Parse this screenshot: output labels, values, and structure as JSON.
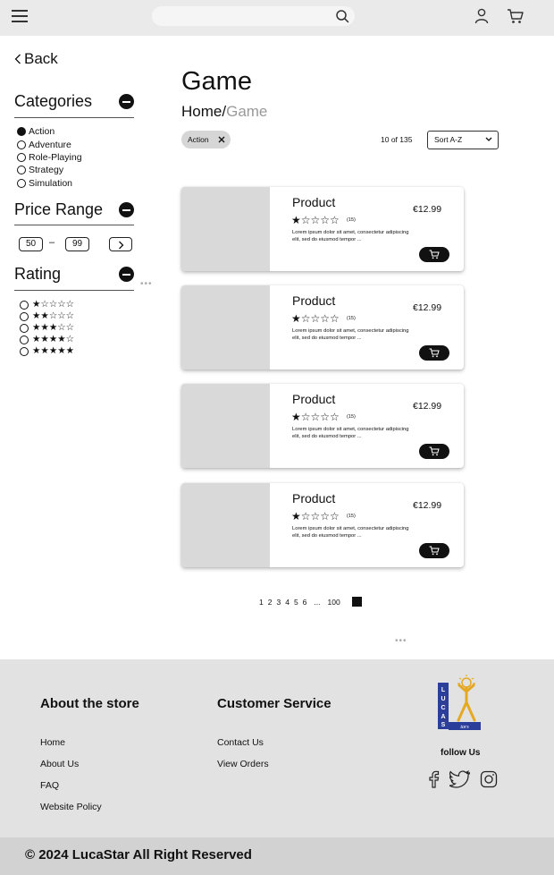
{
  "header": {
    "search_placeholder": "",
    "icons": [
      "hamburger-menu-icon",
      "search-icon",
      "user-icon",
      "cart-icon"
    ]
  },
  "sidebar": {
    "back_label": "Back",
    "categories_title": "Categories",
    "categories": [
      {
        "label": "Action",
        "selected": true
      },
      {
        "label": "Adventure",
        "selected": false
      },
      {
        "label": "Role-Playing",
        "selected": false
      },
      {
        "label": "Strategy",
        "selected": false
      },
      {
        "label": "Simulation",
        "selected": false
      }
    ],
    "price_title": "Price Range",
    "price_min": "50",
    "price_separator": "–",
    "price_max": "99",
    "rating_title": "Rating",
    "ratings": [
      {
        "stars": "★☆☆☆☆",
        "value": 1
      },
      {
        "stars": "★★☆☆☆",
        "value": 2
      },
      {
        "stars": "★★★☆☆",
        "value": 3
      },
      {
        "stars": "★★★★☆",
        "value": 4
      },
      {
        "stars": "★★★★★",
        "value": 5
      }
    ]
  },
  "main": {
    "title": "Game",
    "breadcrumb_home": "Home",
    "breadcrumb_sep": "/",
    "breadcrumb_current": "Game",
    "filter_chip": "Action",
    "result_count": "10 of 135",
    "sort_label": "Sort A-Z",
    "products": [
      {
        "name": "Product",
        "stars": "★☆☆☆☆",
        "reviews": "(15)",
        "description": "Lorem ipsum dolor sit amet, consectetur adipiscing elit, sed do eiusmod tempor ...",
        "price": "€12.99"
      },
      {
        "name": "Product",
        "stars": "★☆☆☆☆",
        "reviews": "(15)",
        "description": "Lorem ipsum dolor sit amet, consectetur adipiscing elit, sed do eiusmod tempor ...",
        "price": "€12.99"
      },
      {
        "name": "Product",
        "stars": "★☆☆☆☆",
        "reviews": "(15)",
        "description": "Lorem ipsum dolor sit amet, consectetur adipiscing elit, sed do eiusmod tempor ...",
        "price": "€12.99"
      },
      {
        "name": "Product",
        "stars": "★☆☆☆☆",
        "reviews": "(15)",
        "description": "Lorem ipsum dolor sit amet, consectetur adipiscing elit, sed do eiusmod tempor ...",
        "price": "€12.99"
      }
    ],
    "pagination": {
      "pages": [
        "1",
        "2",
        "3",
        "4",
        "5",
        "6"
      ],
      "ellipsis": "...",
      "last": "100"
    }
  },
  "footer": {
    "about_title": "About the store",
    "about_links": [
      "Home",
      "About Us",
      "FAQ",
      "Website Policy"
    ],
    "service_title": "Customer Service",
    "service_links": [
      "Contact Us",
      "View Orders"
    ],
    "logo_text": "LUCAStars",
    "follow_label": "follow Us",
    "social_icons": [
      "facebook-icon",
      "twitter-icon",
      "instagram-icon"
    ],
    "copyright": "© 2024 LucaStar All Right Reserved"
  },
  "colors": {
    "header_bg": "#eaeaea",
    "footer_bg": "#e2e2e2",
    "copyright_bg": "#d2d2d2",
    "image_placeholder": "#d9d9d9",
    "chip_bg": "#d6d6d6",
    "logo_blue": "#2b3f9a",
    "logo_gold": "#e5a821"
  }
}
